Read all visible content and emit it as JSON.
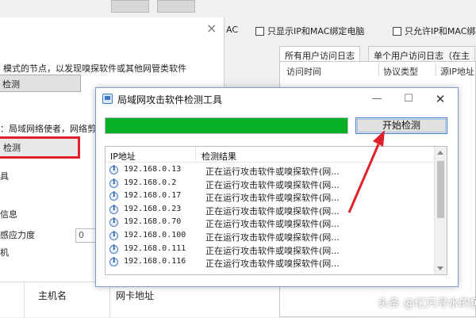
{
  "background_app": {
    "filters": {
      "mac_label": "AC",
      "only_show_bound": "只显示IP和MAC绑定电脑",
      "only_allow_bound": "只允许IP和MAC绑"
    },
    "tabs": [
      {
        "label": "所有用户访问日志"
      },
      {
        "label": "单个用户访问日志（在主"
      }
    ],
    "table_headers": [
      "访问时间",
      "协议类型",
      "源IP地址"
    ]
  },
  "left_dialog": {
    "text_line1": "模式的节点，以发现嗅探软件或其他网管类软件",
    "button1_label": "检测",
    "text_line2": "：局域网络使者，网络剪",
    "button2_label": "检测",
    "label_tools": "具",
    "label_info": "信息",
    "label_sensitivity": "感应力度",
    "input_value": "0",
    "label_machine": "机"
  },
  "bottom_headers": {
    "hostname": "主机名",
    "nic_address": "网卡地址"
  },
  "scan_dialog": {
    "title": "局域网攻击软件检测工具",
    "progress_percent": 100,
    "start_button": "开始检测",
    "columns": [
      "IP地址",
      "检测结果"
    ],
    "rows": [
      {
        "ip": "192.168.0.13",
        "result": "正在运行攻击软件或嗅探软件(网..."
      },
      {
        "ip": "192.168.0.2",
        "result": "正在运行攻击软件或嗅探软件(网..."
      },
      {
        "ip": "192.168.0.17",
        "result": "正在运行攻击软件或嗅探软件(网..."
      },
      {
        "ip": "192.168.0.23",
        "result": "正在运行攻击软件或嗅探软件(网..."
      },
      {
        "ip": "192.168.0.70",
        "result": "正在运行攻击软件或嗅探软件(网..."
      },
      {
        "ip": "192.168.0.100",
        "result": "正在运行攻击软件或嗅探软件(网..."
      },
      {
        "ip": "192.168.0.111",
        "result": "正在运行攻击软件或嗅探软件(网..."
      },
      {
        "ip": "192.168.0.116",
        "result": "正在运行攻击软件或嗅探软件(网..."
      }
    ]
  },
  "colors": {
    "progress_green": "#06b025",
    "annotation_red": "#e0202a",
    "dialog_border": "#7a9fd4"
  },
  "watermark": "头条 @亿只寻水的鱼"
}
